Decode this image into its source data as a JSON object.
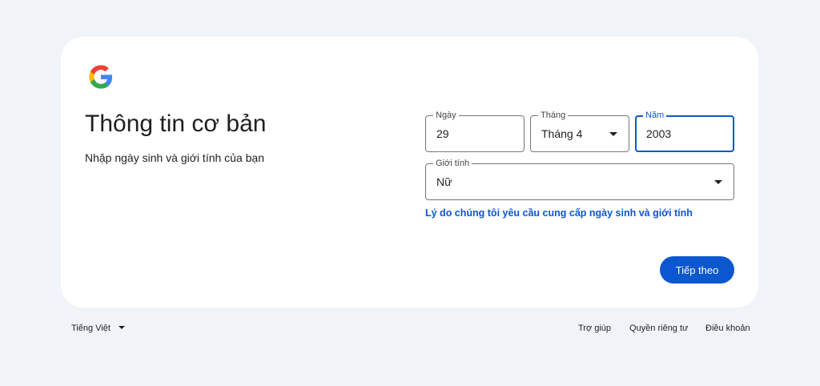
{
  "header": {
    "title": "Thông tin cơ bản",
    "subtitle": "Nhập ngày sinh và giới tính của bạn"
  },
  "form": {
    "day": {
      "label": "Ngày",
      "value": "29"
    },
    "month": {
      "label": "Tháng",
      "value": "Tháng 4"
    },
    "year": {
      "label": "Năm",
      "value": "2003"
    },
    "gender": {
      "label": "Giới tính",
      "value": "Nữ"
    },
    "reason_link": "Lý do chúng tôi yêu cầu cung cấp ngày sinh và giới tính",
    "next_label": "Tiếp theo"
  },
  "footer": {
    "language": "Tiếng Việt",
    "help": "Trợ giúp",
    "privacy": "Quyền riêng tư",
    "terms": "Điều khoản"
  },
  "colors": {
    "page_background": "#f0f4f9",
    "accent": "#0b57d0",
    "google_blue": "#4285f4",
    "google_red": "#ea4335",
    "google_yellow": "#fbbc05",
    "google_green": "#34a853"
  },
  "icons": {
    "logo": "google-logo-icon",
    "dropdown": "caret-down-icon"
  }
}
